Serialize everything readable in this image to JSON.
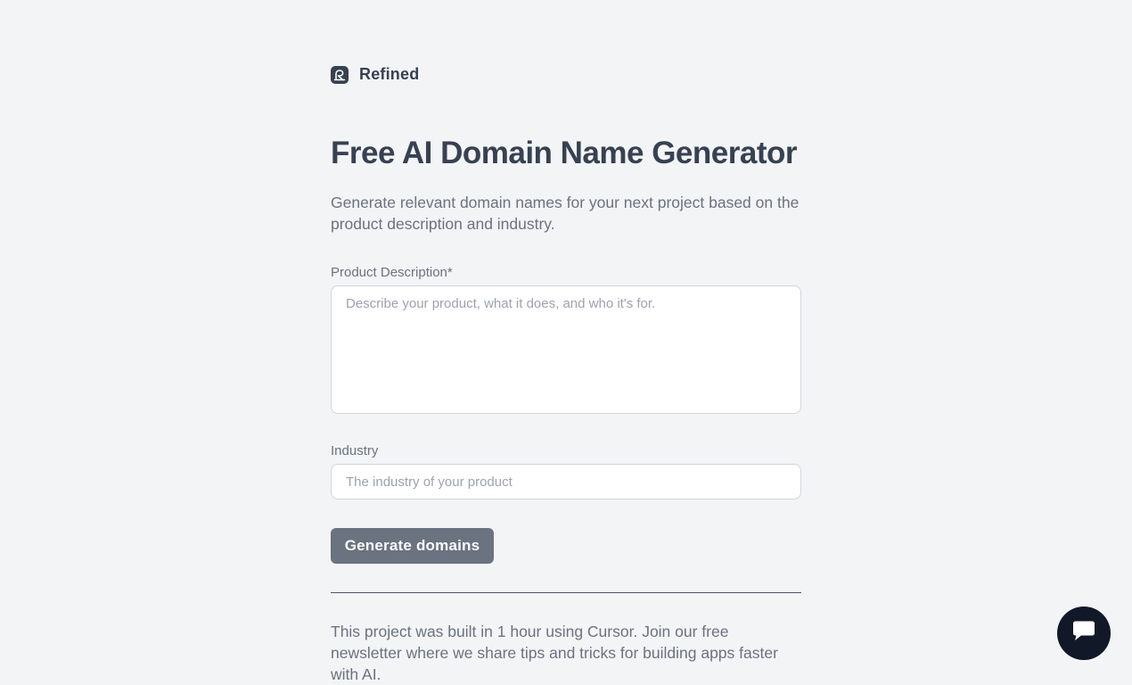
{
  "brand": {
    "name": "Refined",
    "logo_icon": "refined-logo-icon"
  },
  "hero": {
    "title": "Free AI Domain Name Generator",
    "subtitle": "Generate relevant domain names for your next project based on the product description and industry."
  },
  "form": {
    "description_label": "Product Description*",
    "description_placeholder": "Describe your product, what it does, and who it's for.",
    "description_value": "",
    "industry_label": "Industry",
    "industry_placeholder": "The industry of your product",
    "industry_value": "",
    "submit_label": "Generate domains"
  },
  "footer": {
    "text": "This project was built in 1 hour using Cursor. Join our free newsletter where we share tips and tricks for building apps faster with AI."
  },
  "chat": {
    "icon": "chat-icon"
  },
  "colors": {
    "background": "#f3f4f6",
    "text_primary": "#374151",
    "text_secondary": "#6b7280",
    "button": "#6b7280",
    "chat_bubble": "#111827"
  }
}
